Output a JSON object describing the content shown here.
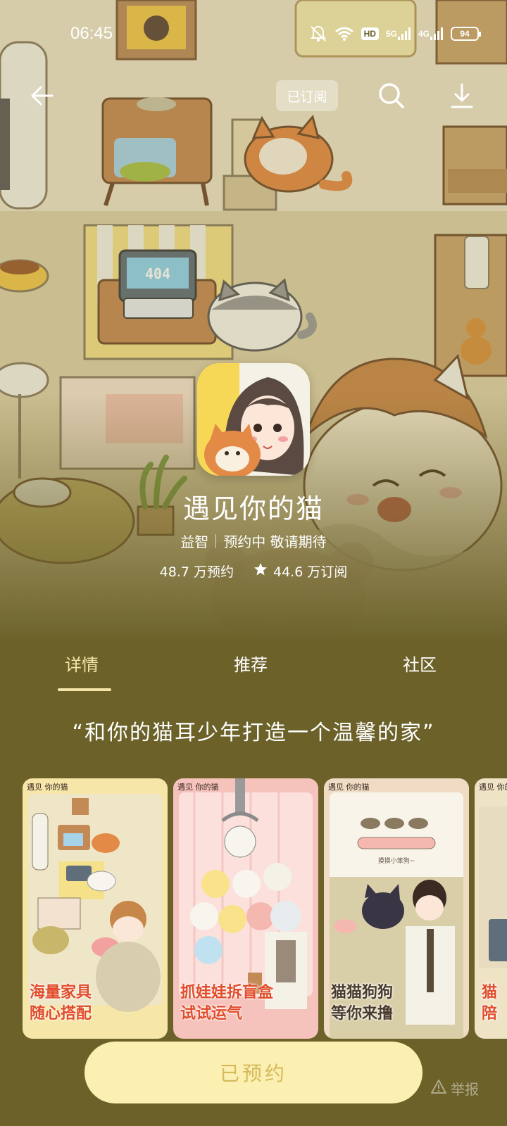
{
  "status_bar": {
    "time": "06:45",
    "hd_label": "HD",
    "net1": "5G",
    "net2": "4G",
    "battery": "94"
  },
  "nav": {
    "subscribed_label": "已订阅",
    "icons": [
      "back-arrow-icon",
      "search-icon",
      "download-icon"
    ]
  },
  "hero": {
    "screen_text": "404"
  },
  "app": {
    "name": "遇见你的猫",
    "category": "益智",
    "status": "预约中 敬请期待",
    "reservations": "48.7 万预约",
    "subscriptions": "44.6 万订阅"
  },
  "tabs": [
    {
      "label": "详情",
      "active": true
    },
    {
      "label": "推荐",
      "active": false
    },
    {
      "label": "社区",
      "active": false
    }
  ],
  "tagline": "“和你的猫耳少年打造一个温馨的家”",
  "screenshots": [
    {
      "badge": "遇见 你的猫",
      "caption_line1": "海量家具",
      "caption_line2": "随心搭配"
    },
    {
      "badge": "遇见 你的猫",
      "caption_line1": "抓娃娃拆盲盒",
      "caption_line2": "试试运气"
    },
    {
      "badge": "遇见 你的猫",
      "caption_line1": "猫猫狗狗",
      "caption_line2": "等你来撸",
      "inner_text": "摸摸小笨狗~"
    },
    {
      "badge": "遇见 你的猫",
      "caption_line1": "猫",
      "caption_line2": "陪"
    }
  ],
  "actions": {
    "reserve_label": "已预约",
    "report_label": "举报"
  },
  "colors": {
    "bg": "#6b6129",
    "accent": "#f4e5a6",
    "button_bg": "#fbf0b2",
    "button_text": "#d5b95a"
  }
}
